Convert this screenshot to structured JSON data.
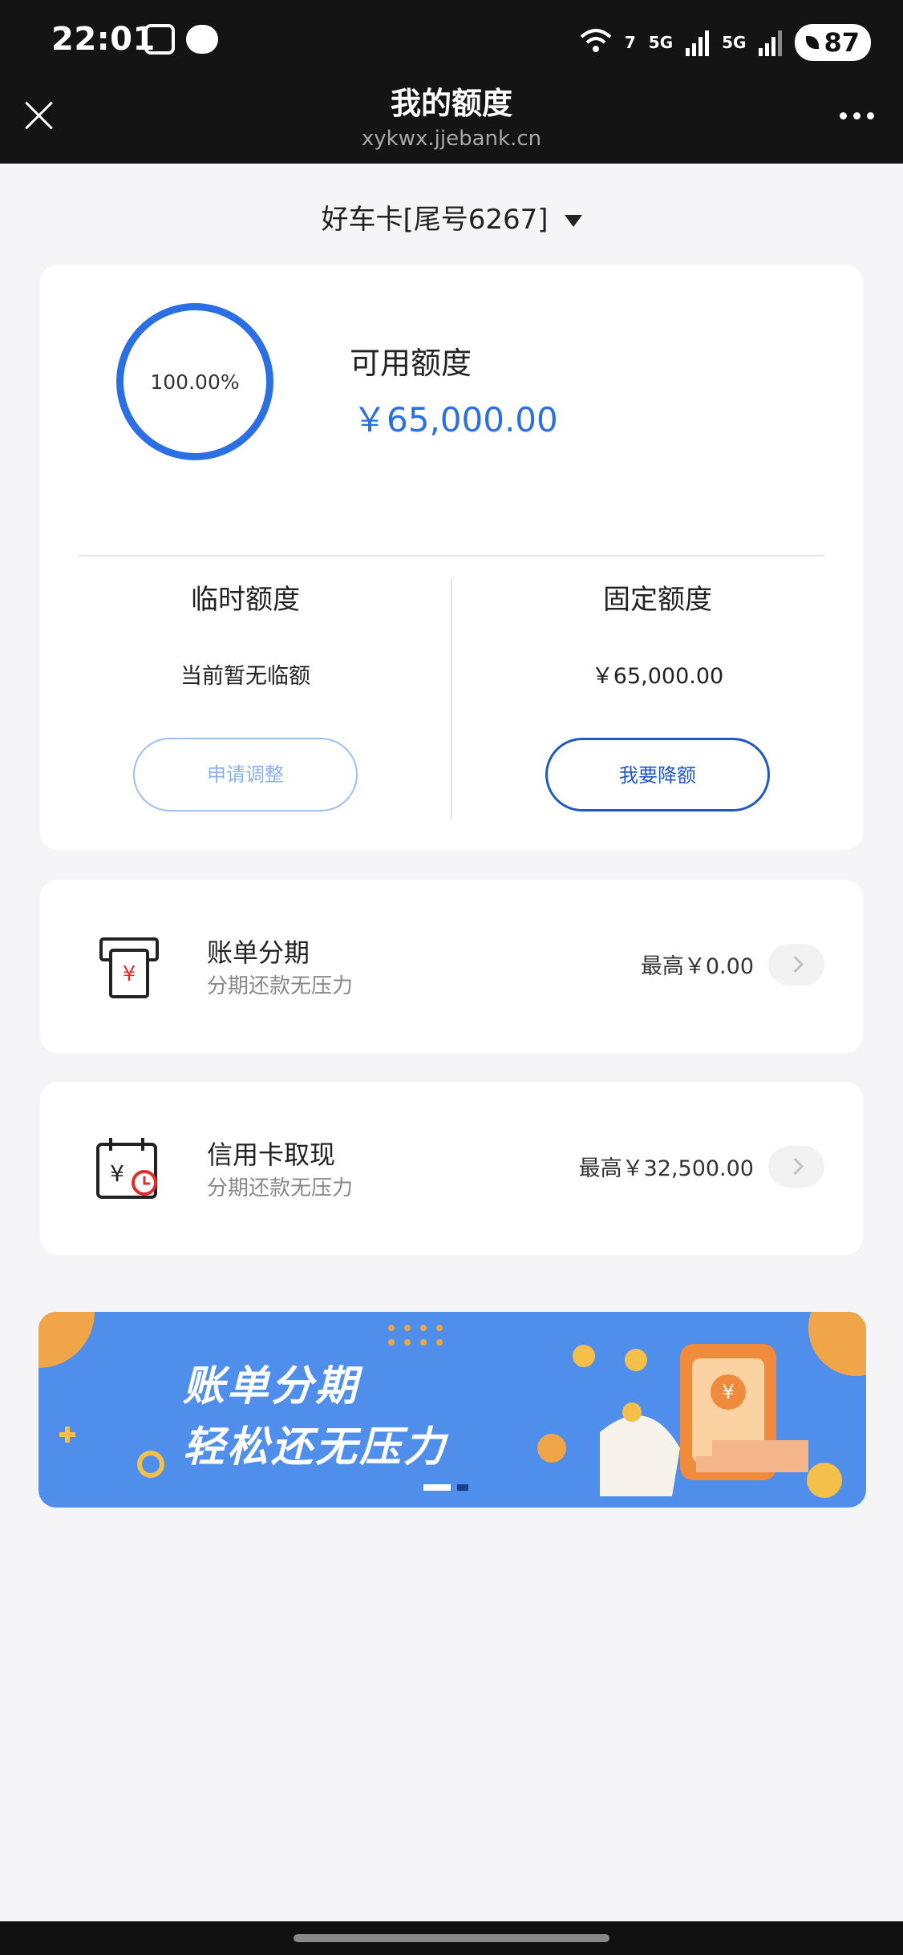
{
  "status_bar": {
    "time": "22:01",
    "wifi_label": "7",
    "signal1_label": "5G",
    "signal2_label": "5G",
    "battery": "87"
  },
  "header": {
    "title": "我的额度",
    "url": "xykwx.jjebank.cn",
    "close_icon": "close-icon",
    "more_icon": "more-dots-icon"
  },
  "card_selector": {
    "label": "好车卡[尾号6267]"
  },
  "quota": {
    "percent_label": "100.00%",
    "percent_value": 1.0,
    "available_label": "可用额度",
    "available_value": "￥65,000.00",
    "temporary": {
      "title": "临时额度",
      "value": "当前暂无临额",
      "button": "申请调整"
    },
    "fixed": {
      "title": "固定额度",
      "value": "￥65,000.00",
      "button": "我要降额"
    }
  },
  "features": [
    {
      "title": "账单分期",
      "subtitle": "分期还款无压力",
      "max": "最高￥0.00",
      "icon": "bill-yuan-icon"
    },
    {
      "title": "信用卡取现",
      "subtitle": "分期还款无压力",
      "max": "最高￥32,500.00",
      "icon": "calendar-yuan-clock-icon"
    }
  ],
  "banner": {
    "line1": "账单分期",
    "line2": "轻松还无压力"
  },
  "colors": {
    "accent": "#2b6fe5",
    "dark_blue": "#1f57c6",
    "banner": "#4f8eeb",
    "header_bg": "#141414",
    "icon_red": "#e12c2c"
  }
}
